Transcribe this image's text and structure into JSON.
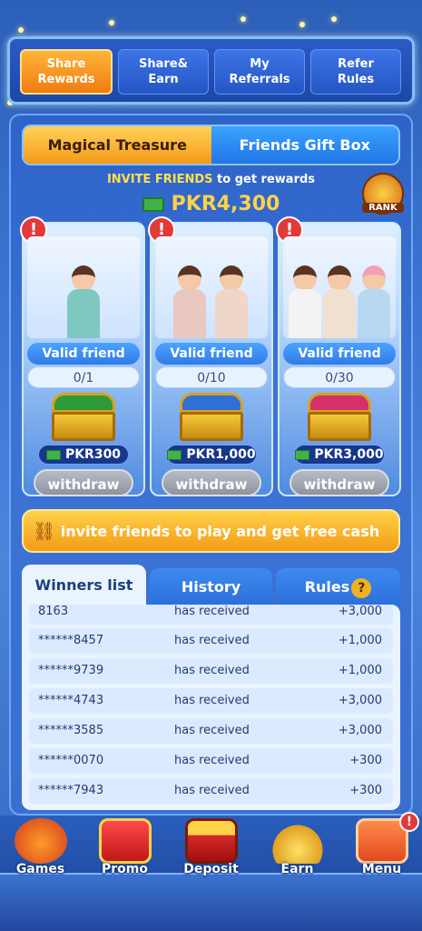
{
  "top_tabs": [
    {
      "label": "Share\nRewards"
    },
    {
      "label": "Share&\nEarn"
    },
    {
      "label": "My\nReferrals"
    },
    {
      "label": "Refer\nRules"
    }
  ],
  "sub_tabs": [
    {
      "label": "Magical Treasure"
    },
    {
      "label": "Friends Gift Box"
    }
  ],
  "invite": {
    "highlight": "INVITE FRIENDS",
    "rest": " to get  rewards",
    "amount": "PKR4,300",
    "rank_label": "RANK"
  },
  "cards": [
    {
      "alert": "!",
      "valid_label": "Valid friend",
      "progress": "0/1",
      "prize": "PKR300",
      "withdraw": "withdraw"
    },
    {
      "alert": "!",
      "valid_label": "Valid friend",
      "progress": "0/10",
      "prize": "PKR1,000",
      "withdraw": "withdraw"
    },
    {
      "alert": "!",
      "valid_label": "Valid friend",
      "progress": "0/30",
      "prize": "PKR3,000",
      "withdraw": "withdraw"
    }
  ],
  "invite_button": "invite friends to play and get free cash",
  "list_tabs": [
    {
      "label": "Winners list"
    },
    {
      "label": "History"
    },
    {
      "label": "Rules"
    }
  ],
  "help_glyph": "?",
  "winners": [
    {
      "user": "8163",
      "action": "has received",
      "amount": "+3,000"
    },
    {
      "user": "******8457",
      "action": "has received",
      "amount": "+1,000"
    },
    {
      "user": "******9739",
      "action": "has received",
      "amount": "+1,000"
    },
    {
      "user": "******4743",
      "action": "has received",
      "amount": "+3,000"
    },
    {
      "user": "******3585",
      "action": "has received",
      "amount": "+3,000"
    },
    {
      "user": "******0070",
      "action": "has received",
      "amount": "+300"
    },
    {
      "user": "******7943",
      "action": "has received",
      "amount": "+300"
    }
  ],
  "bottom_nav": [
    {
      "label": "Games"
    },
    {
      "label": "Promo"
    },
    {
      "label": "Deposit"
    },
    {
      "label": "Earn"
    },
    {
      "label": "Menu"
    }
  ],
  "menu_badge": "!",
  "colors": {
    "accent_orange": "#f59a17",
    "accent_yellow": "#ffd24a",
    "primary_blue": "#2f6fd6",
    "alert_red": "#e23a3a"
  }
}
